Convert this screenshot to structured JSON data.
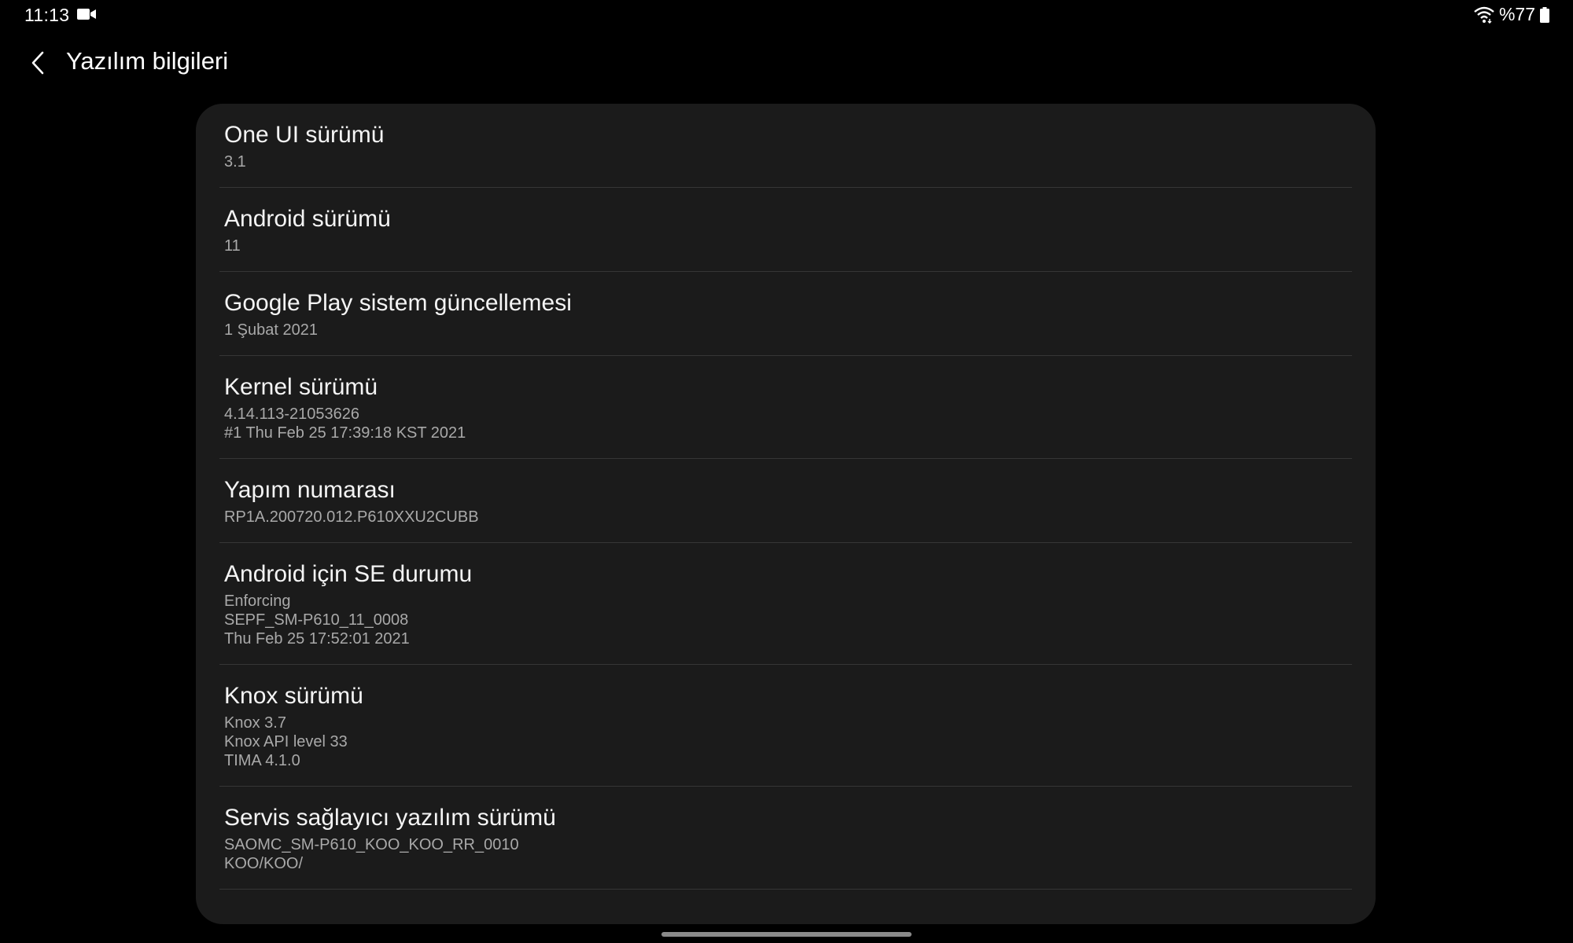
{
  "status_bar": {
    "time": "11:13",
    "battery_percent": "%77",
    "icons": [
      "video-camera-icon",
      "wifi-icon",
      "battery-icon"
    ]
  },
  "header": {
    "title": "Yazılım bilgileri",
    "back_icon": "chevron-left-icon"
  },
  "items": [
    {
      "title": "One UI sürümü",
      "lines": [
        "3.1"
      ]
    },
    {
      "title": "Android sürümü",
      "lines": [
        "11"
      ]
    },
    {
      "title": "Google Play sistem güncellemesi",
      "lines": [
        "1 Şubat 2021"
      ]
    },
    {
      "title": "Kernel sürümü",
      "lines": [
        "4.14.113-21053626",
        "#1 Thu Feb 25 17:39:18 KST 2021"
      ]
    },
    {
      "title": "Yapım numarası",
      "lines": [
        "RP1A.200720.012.P610XXU2CUBB"
      ]
    },
    {
      "title": "Android için SE durumu",
      "lines": [
        "Enforcing",
        "SEPF_SM-P610_11_0008",
        "Thu Feb 25 17:52:01 2021"
      ]
    },
    {
      "title": "Knox sürümü",
      "lines": [
        "Knox 3.7",
        "Knox API level 33",
        "TIMA 4.1.0"
      ]
    },
    {
      "title": "Servis sağlayıcı yazılım sürümü",
      "lines": [
        "SAOMC_SM-P610_KOO_KOO_RR_0010",
        "KOO/KOO/"
      ]
    }
  ],
  "colors": {
    "background": "#000000",
    "card": "#1b1b1b",
    "divider": "#363636",
    "title_text": "#f4f4f4",
    "secondary_text": "#a9a9a9"
  }
}
